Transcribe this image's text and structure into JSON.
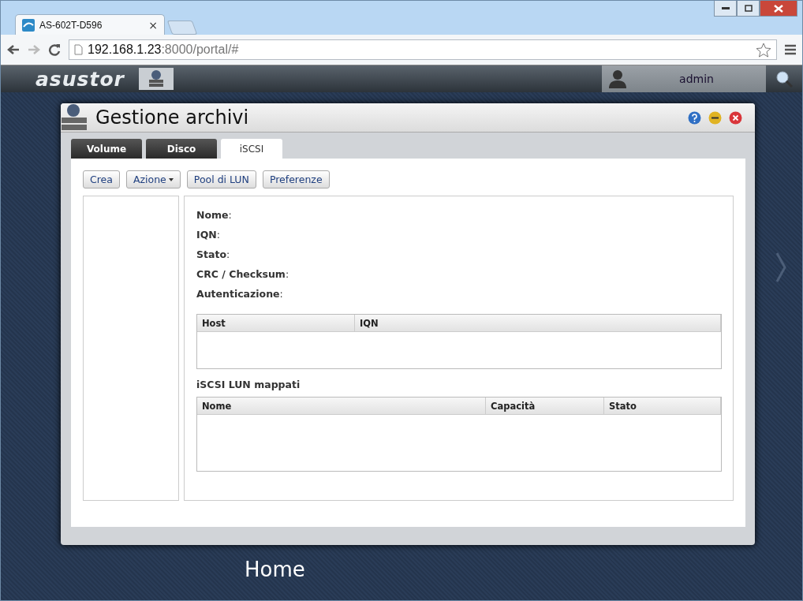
{
  "browser": {
    "tab_title": "AS-602T-D596",
    "tab_close": "×",
    "address_host": "192.168.1.23",
    "address_rest": ":8000/portal/#"
  },
  "topbar": {
    "logo": "asustor",
    "user": "admin"
  },
  "window": {
    "title": "Gestione archivi"
  },
  "tabs": [
    {
      "label": "Volume",
      "selected": false
    },
    {
      "label": "Disco",
      "selected": false
    },
    {
      "label": "iSCSI",
      "selected": true
    }
  ],
  "toolbar": [
    {
      "label": "Crea",
      "kind": "plain"
    },
    {
      "label": "Azione",
      "kind": "dropdown"
    },
    {
      "label": "Pool di LUN",
      "kind": "plain"
    },
    {
      "label": "Preferenze",
      "kind": "plain"
    }
  ],
  "details": [
    "**Nome**:",
    "**IQN**:",
    "**Stato**:",
    "**CRC / Checksum**:",
    "**Autenticazione**:"
  ],
  "hosts_table": {
    "columns": [
      "Host",
      "IQN"
    ]
  },
  "luns": {
    "title": "iSCSI LUN mappati",
    "columns": [
      "Nome",
      "Capacità",
      "Stato"
    ]
  },
  "desktop": {
    "label": "Home"
  }
}
